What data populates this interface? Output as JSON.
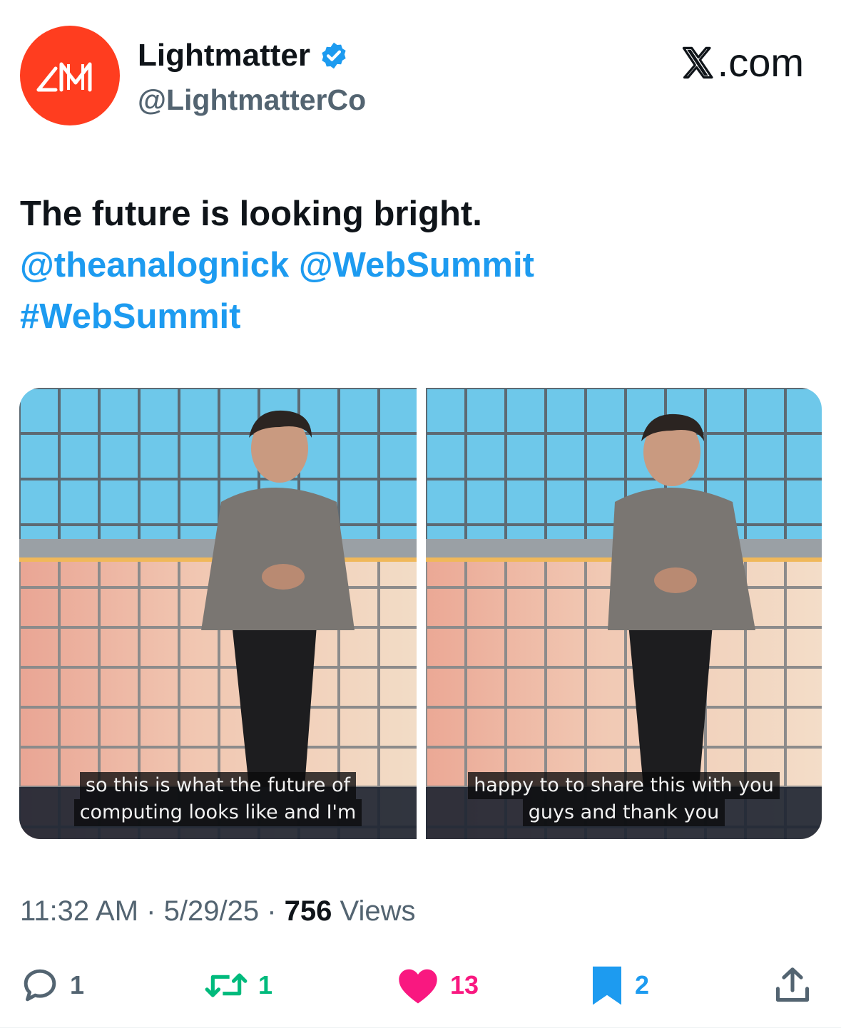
{
  "header": {
    "display_name": "Lightmatter",
    "handle": "@LightmatterCo",
    "brand_suffix": ".com",
    "avatar_color": "#ff3d1f",
    "verified_color": "#1d9bf0"
  },
  "tweet": {
    "text": "The future is looking bright.",
    "mention_1": "@theanalognick",
    "mention_2": "@WebSummit",
    "hashtag": "#WebSummit",
    "link_color": "#1d9bf0"
  },
  "media": {
    "left_caption_line1": "so this is what the future of",
    "left_caption_line2": "computing looks like and I'm",
    "right_caption_line1": "happy to to share this with you",
    "right_caption_line2": "guys and thank you"
  },
  "meta": {
    "time": "11:32 AM",
    "separator": "·",
    "date": "5/29/25",
    "views_count": "756",
    "views_label": "Views"
  },
  "actions": {
    "replies": "1",
    "reposts": "1",
    "likes": "13",
    "bookmarks": "2",
    "repost_color": "#00ba7c",
    "like_color": "#f91880",
    "bookmark_color": "#1d9bf0"
  },
  "icons": {
    "avatar_logo": "lightmatter-logo",
    "verified": "verified-badge-icon",
    "brand": "x-logo-icon",
    "reply": "reply-icon",
    "repost": "repost-icon",
    "like": "heart-icon",
    "bookmark": "bookmark-icon",
    "share": "share-icon"
  }
}
